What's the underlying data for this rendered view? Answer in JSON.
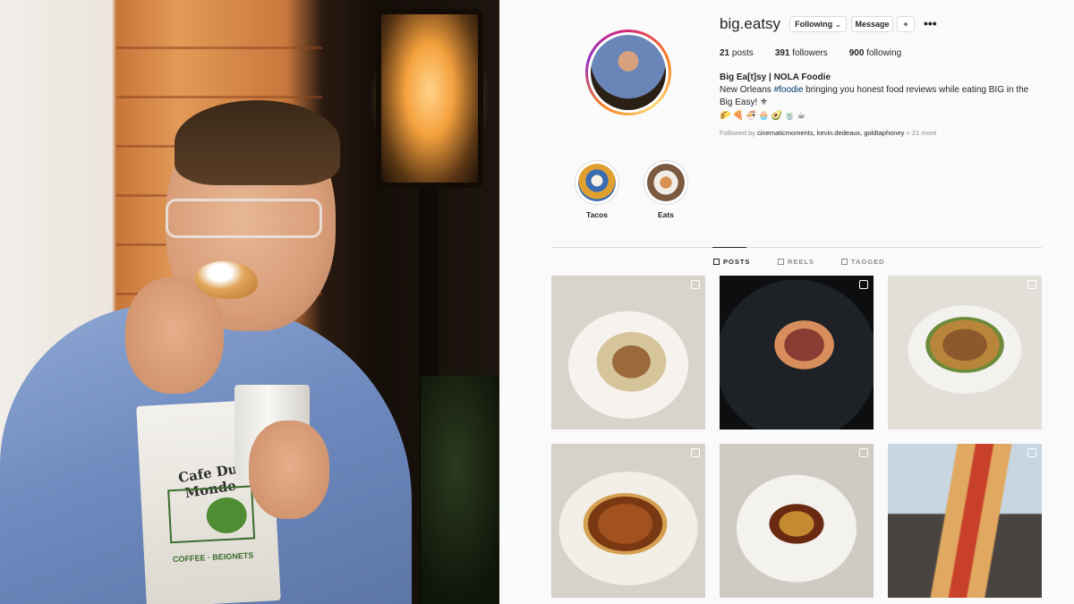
{
  "profile": {
    "username": "big.eatsy",
    "following_button": "Following",
    "message_button": "Message",
    "stats": {
      "posts_count": "21",
      "posts_label": "posts",
      "followers_count": "391",
      "followers_label": "followers",
      "following_count": "900",
      "following_label": "following"
    },
    "bio": {
      "name": "Big Ea[t]sy | NOLA Foodie",
      "line_before_tag": "New Orleans ",
      "hashtag": "#foodie",
      "line_after_tag": " bringing you honest food reviews while eating BIG in the Big Easy! ⚜",
      "emojis": "🌮🍕🍜🧁🥑🍵☕",
      "followed_by_prefix": "Followed by ",
      "followed_by_names": "cinematicmoments, kevin.dedeaux, goldtaphoney",
      "followed_by_more": " + 21 more"
    }
  },
  "highlights": [
    {
      "label": "Tacos"
    },
    {
      "label": "Eats"
    }
  ],
  "tabs": {
    "posts": "POSTS",
    "reels": "REELS",
    "tagged": "TAGGED"
  },
  "bag": {
    "brand": "Cafe Du Monde",
    "tagline": "COFFEE · BEIGNETS"
  },
  "colors": {
    "text": "#262626",
    "secondary": "#8e8e8e",
    "link": "#00376b",
    "border": "#dbdbdb",
    "background": "#fafafa"
  }
}
